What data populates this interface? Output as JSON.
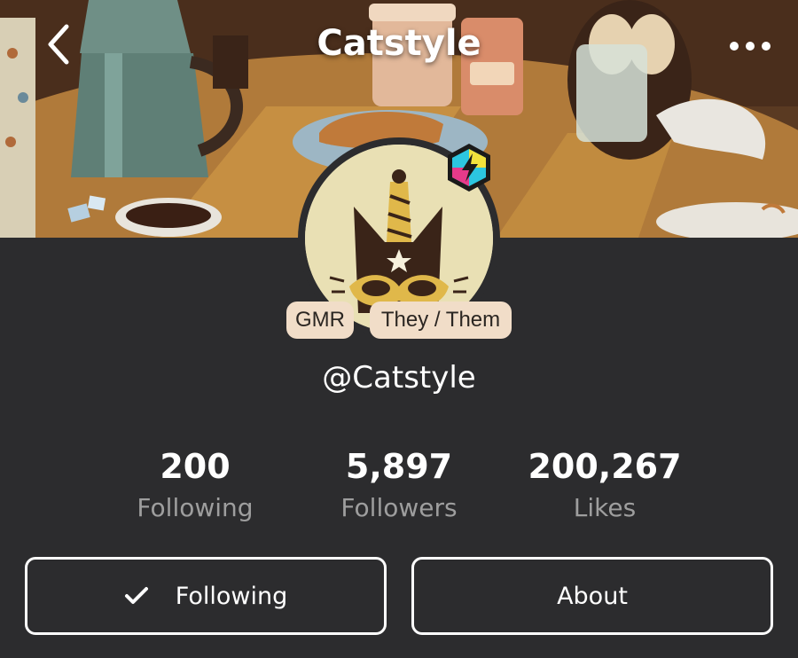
{
  "header": {
    "title": "Catstyle",
    "back_icon": "chevron-left-icon",
    "more_icon": "more-horizontal-icon"
  },
  "profile": {
    "handle": "@Catstyle",
    "tags": [
      "GMR",
      "They / Them"
    ],
    "verified_icon": "lightning-hexagon-icon"
  },
  "stats": [
    {
      "value": "200",
      "label": "Following"
    },
    {
      "value": "5,897",
      "label": "Followers"
    },
    {
      "value": "200,267",
      "label": "Likes"
    }
  ],
  "actions": {
    "following_label": "Following",
    "about_label": "About",
    "following_icon": "check-icon"
  },
  "colors": {
    "background": "#2c2c2e",
    "pill_bg": "#f1ddc8",
    "stat_label": "#9e9e9e",
    "text": "#ffffff"
  }
}
